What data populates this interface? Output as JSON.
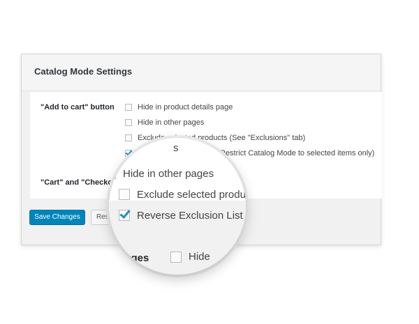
{
  "panel": {
    "title": "Catalog Mode Settings"
  },
  "settings": {
    "add_to_cart": {
      "label": "\"Add to cart\" button",
      "options": [
        {
          "label": "Hide in product details page",
          "checked": false
        },
        {
          "label": "Hide in other pages",
          "checked": false
        },
        {
          "label": "Exclude selected products (See \"Exclusions\" tab)",
          "checked": false
        },
        {
          "label": "Reverse Exclusion List (Restrict Catalog Mode to selected items only)",
          "checked": true
        }
      ]
    },
    "cart_checkout": {
      "label": "\"Cart\" and \"Checkout\""
    }
  },
  "buttons": {
    "save": "Save Changes",
    "reset": "Reset Defaults"
  },
  "magnifier": {
    "top_fragment": "s",
    "options": [
      {
        "label": "Hide in other pages",
        "checked": false
      },
      {
        "label": "Exclude selected products",
        "checked": false
      },
      {
        "label": "Reverse Exclusion List (Restrict",
        "checked": true
      }
    ],
    "pages_fragment": "pages",
    "hide_label": "Hide"
  },
  "colors": {
    "primary_button": "#0085ba",
    "checkmark": "#1e8cbe"
  }
}
